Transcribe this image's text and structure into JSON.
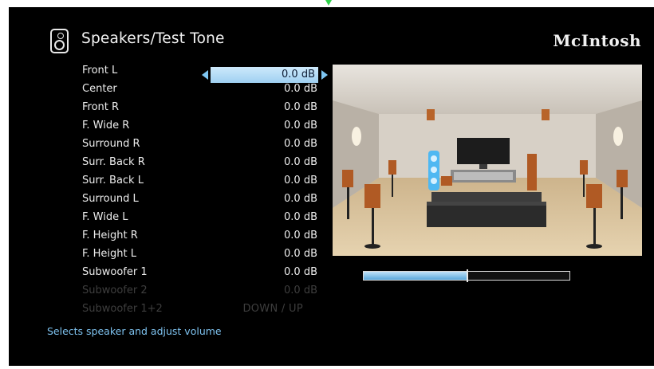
{
  "header": {
    "title": "Speakers/Test Tone",
    "brand": "McIntosh",
    "icon": "speaker-icon"
  },
  "speakers": [
    {
      "label": "Front L",
      "value": "0.0 dB",
      "selected": true
    },
    {
      "label": "Center",
      "value": "0.0 dB"
    },
    {
      "label": "Front R",
      "value": "0.0 dB"
    },
    {
      "label": "F. Wide R",
      "value": "0.0 dB"
    },
    {
      "label": "Surround R",
      "value": "0.0 dB"
    },
    {
      "label": "Surr. Back R",
      "value": "0.0 dB"
    },
    {
      "label": "Surr. Back L",
      "value": "0.0 dB"
    },
    {
      "label": "Surround L",
      "value": "0.0 dB"
    },
    {
      "label": "F. Wide L",
      "value": "0.0 dB"
    },
    {
      "label": "F. Height R",
      "value": "0.0 dB"
    },
    {
      "label": "F. Height L",
      "value": "0.0 dB"
    },
    {
      "label": "Subwoofer 1",
      "value": "0.0 dB"
    },
    {
      "label": "Subwoofer 2",
      "value": "0.0 dB",
      "disabled": true
    },
    {
      "label": "Subwoofer 1+2",
      "value": "DOWN / UP",
      "disabled": true
    }
  ],
  "hint": "Selects speaker and adjust volume",
  "level_meter": {
    "fill_fraction": 0.5
  },
  "colors": {
    "selection": "#a9d7f5",
    "hint_text": "#7ec2ef",
    "disabled_text": "#3e3e3e",
    "background": "#000000"
  }
}
